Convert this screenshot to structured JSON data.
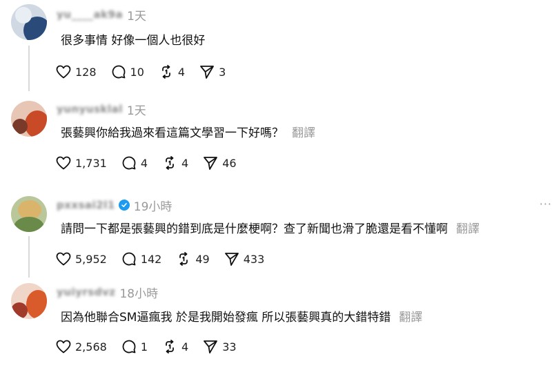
{
  "comments": [
    {
      "username": "yu____ak9a",
      "time": "1天",
      "text": "很多事情 好像一個人也很好",
      "translate": "",
      "verified": false,
      "likes": "128",
      "replies": "10",
      "reposts": "4",
      "shares": "3",
      "avatar_colors": [
        "#8fb4d9",
        "#2a4a7a"
      ]
    },
    {
      "username": "yunyusklal",
      "time": "1天",
      "text": "張藝興你給我過來看這篇文學習一下好嗎？",
      "translate": "翻譯",
      "verified": false,
      "likes": "1,731",
      "replies": "4",
      "reposts": "4",
      "shares": "46",
      "avatar_colors": [
        "#d96a3a",
        "#7a3a2a"
      ]
    },
    {
      "username": "pxxsai2l1",
      "time": "19小時",
      "text": "請問一下都是張藝興的錯到底是什麼梗啊？查了新聞也滑了脆還是看不懂啊",
      "translate": "翻譯",
      "verified": true,
      "more": "···",
      "likes": "5,952",
      "replies": "142",
      "reposts": "49",
      "shares": "433",
      "avatar_colors": [
        "#c9a24a",
        "#5a7a3a"
      ]
    },
    {
      "username": "yuiyrsdvz",
      "time": "18小時",
      "text": "因為他聯合SM逼瘋我 於是我開始發瘋 所以張藝興真的大錯特錯",
      "translate": "翻譯",
      "verified": false,
      "likes": "2,568",
      "replies": "1",
      "reposts": "4",
      "shares": "33",
      "avatar_colors": [
        "#e07040",
        "#a03a2a"
      ]
    }
  ]
}
